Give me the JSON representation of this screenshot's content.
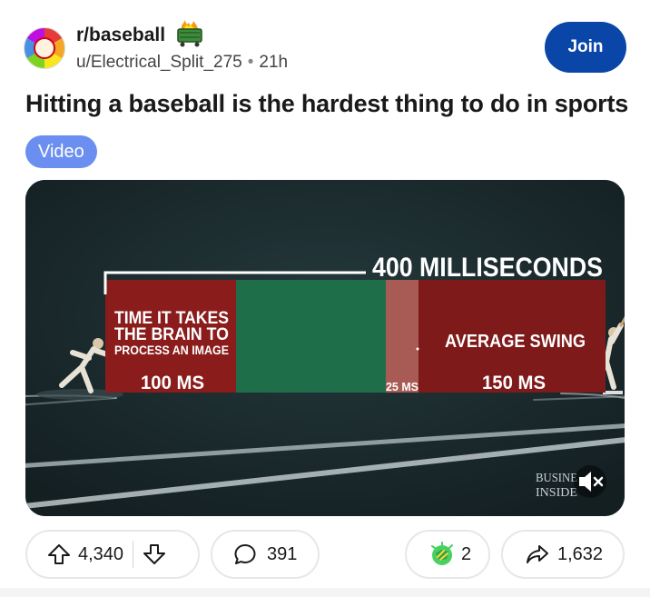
{
  "post": {
    "subreddit": "r/baseball",
    "author": "u/Electrical_Split_275",
    "time": "21h",
    "join_label": "Join",
    "title": "Hitting a baseball is the hardest thing to do in sports",
    "flair": "Video"
  },
  "video": {
    "headline": "400 MILLISECONDS",
    "segment1_line1": "TIME IT TAKES",
    "segment1_line2": "THE BRAIN TO",
    "segment1_line3": "PROCESS AN IMAGE",
    "segment1_ms": "100 MS",
    "segment2_ms": "25 MS",
    "segment3_label": "AVERAGE SWING",
    "segment3_ms": "150 MS",
    "watermark_line1": "BUSINE",
    "watermark_line2": "INSIDE",
    "colors": {
      "red": "#8b1c1c",
      "green": "#1f6e4a",
      "pink": "#a85a55",
      "background": "#1c2b2e"
    }
  },
  "actions": {
    "upvotes": "4,340",
    "comments": "391",
    "awards": "2",
    "shares": "1,632"
  },
  "icons": [
    "avatar",
    "dumpster-fire-badge-icon",
    "upvote-icon",
    "downvote-icon",
    "comment-icon",
    "award-icon",
    "share-icon",
    "mute-icon"
  ]
}
